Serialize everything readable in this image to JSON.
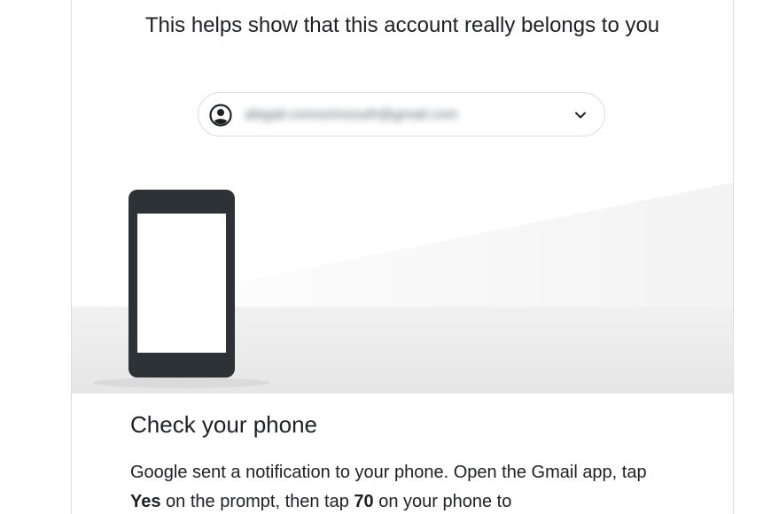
{
  "subtitle": "This helps show that this account really belongs to you",
  "account": {
    "email": "abigail.connorinsouth@gmail.com",
    "icon": "account-circle-icon",
    "dropdown_icon": "chevron-down-icon"
  },
  "illustration": {
    "icon": "phone-illustration",
    "phone_color": "#2d3236"
  },
  "heading": "Check your phone",
  "body": {
    "part1": "Google sent a notification to your phone. Open the Gmail app, tap ",
    "bold1": "Yes",
    "part2": " on the prompt, then tap ",
    "bold2": "70",
    "part3": " on your phone to"
  }
}
